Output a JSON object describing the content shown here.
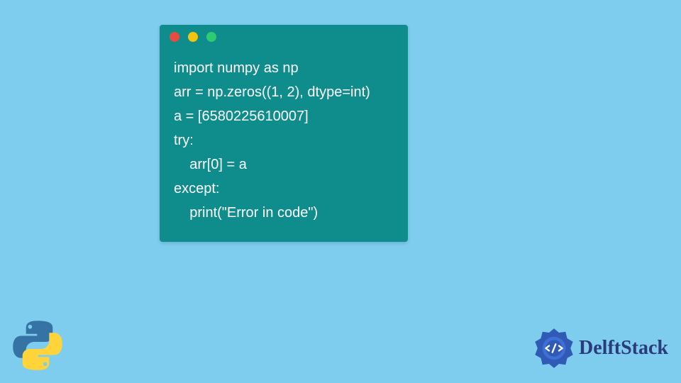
{
  "code": {
    "lines": [
      "import numpy as np",
      "arr = np.zeros((1, 2), dtype=int)",
      "a = [6580225610007]",
      "try:",
      "    arr[0] = a",
      "except:",
      "    print(\"Error in code\")"
    ]
  },
  "traffic_lights": {
    "red": "#e74c3c",
    "yellow": "#f1c40f",
    "green": "#2ecc71"
  },
  "brand": {
    "name": "DelftStack"
  }
}
